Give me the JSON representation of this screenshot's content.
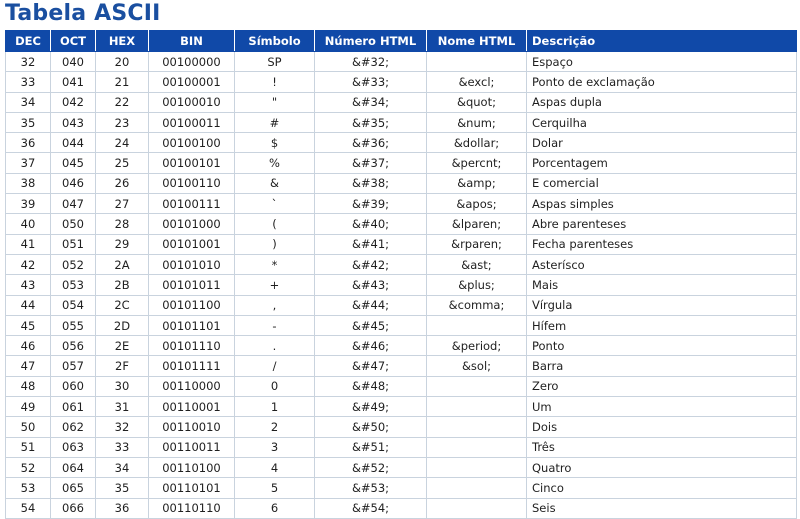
{
  "title": "Tabela ASCII",
  "headers": {
    "dec": "DEC",
    "oct": "OCT",
    "hex": "HEX",
    "bin": "BIN",
    "symbol": "Símbolo",
    "html_number": "Número HTML",
    "html_name": "Nome HTML",
    "description": "Descrição"
  },
  "rows": [
    {
      "dec": "32",
      "oct": "040",
      "hex": "20",
      "bin": "00100000",
      "symbol": "SP",
      "html_number": "&#32;",
      "html_name": "",
      "description": "Espaço"
    },
    {
      "dec": "33",
      "oct": "041",
      "hex": "21",
      "bin": "00100001",
      "symbol": "!",
      "html_number": "&#33;",
      "html_name": "&excl;",
      "description": "Ponto de exclamação"
    },
    {
      "dec": "34",
      "oct": "042",
      "hex": "22",
      "bin": "00100010",
      "symbol": "\"",
      "html_number": "&#34;",
      "html_name": "&quot;",
      "description": "Aspas dupla"
    },
    {
      "dec": "35",
      "oct": "043",
      "hex": "23",
      "bin": "00100011",
      "symbol": "#",
      "html_number": "&#35;",
      "html_name": "&num;",
      "description": "Cerquilha"
    },
    {
      "dec": "36",
      "oct": "044",
      "hex": "24",
      "bin": "00100100",
      "symbol": "$",
      "html_number": "&#36;",
      "html_name": "&dollar;",
      "description": "Dolar"
    },
    {
      "dec": "37",
      "oct": "045",
      "hex": "25",
      "bin": "00100101",
      "symbol": "%",
      "html_number": "&#37;",
      "html_name": "&percnt;",
      "description": "Porcentagem"
    },
    {
      "dec": "38",
      "oct": "046",
      "hex": "26",
      "bin": "00100110",
      "symbol": "&",
      "html_number": "&#38;",
      "html_name": "&amp;",
      "description": "E comercial"
    },
    {
      "dec": "39",
      "oct": "047",
      "hex": "27",
      "bin": "00100111",
      "symbol": "`",
      "html_number": "&#39;",
      "html_name": "&apos;",
      "description": "Aspas simples"
    },
    {
      "dec": "40",
      "oct": "050",
      "hex": "28",
      "bin": "00101000",
      "symbol": "(",
      "html_number": "&#40;",
      "html_name": "&lparen;",
      "description": "Abre parenteses"
    },
    {
      "dec": "41",
      "oct": "051",
      "hex": "29",
      "bin": "00101001",
      "symbol": ")",
      "html_number": "&#41;",
      "html_name": "&rparen;",
      "description": "Fecha parenteses"
    },
    {
      "dec": "42",
      "oct": "052",
      "hex": "2A",
      "bin": "00101010",
      "symbol": "*",
      "html_number": "&#42;",
      "html_name": "&ast;",
      "description": "Asterísco"
    },
    {
      "dec": "43",
      "oct": "053",
      "hex": "2B",
      "bin": "00101011",
      "symbol": "+",
      "html_number": "&#43;",
      "html_name": "&plus;",
      "description": "Mais"
    },
    {
      "dec": "44",
      "oct": "054",
      "hex": "2C",
      "bin": "00101100",
      "symbol": ",",
      "html_number": "&#44;",
      "html_name": "&comma;",
      "description": "Vírgula"
    },
    {
      "dec": "45",
      "oct": "055",
      "hex": "2D",
      "bin": "00101101",
      "symbol": "-",
      "html_number": "&#45;",
      "html_name": "",
      "description": "Hífem"
    },
    {
      "dec": "46",
      "oct": "056",
      "hex": "2E",
      "bin": "00101110",
      "symbol": ".",
      "html_number": "&#46;",
      "html_name": "&period;",
      "description": "Ponto"
    },
    {
      "dec": "47",
      "oct": "057",
      "hex": "2F",
      "bin": "00101111",
      "symbol": "/",
      "html_number": "&#47;",
      "html_name": "&sol;",
      "description": "Barra"
    },
    {
      "dec": "48",
      "oct": "060",
      "hex": "30",
      "bin": "00110000",
      "symbol": "0",
      "html_number": "&#48;",
      "html_name": "",
      "description": "Zero"
    },
    {
      "dec": "49",
      "oct": "061",
      "hex": "31",
      "bin": "00110001",
      "symbol": "1",
      "html_number": "&#49;",
      "html_name": "",
      "description": "Um"
    },
    {
      "dec": "50",
      "oct": "062",
      "hex": "32",
      "bin": "00110010",
      "symbol": "2",
      "html_number": "&#50;",
      "html_name": "",
      "description": "Dois"
    },
    {
      "dec": "51",
      "oct": "063",
      "hex": "33",
      "bin": "00110011",
      "symbol": "3",
      "html_number": "&#51;",
      "html_name": "",
      "description": "Três"
    },
    {
      "dec": "52",
      "oct": "064",
      "hex": "34",
      "bin": "00110100",
      "symbol": "4",
      "html_number": "&#52;",
      "html_name": "",
      "description": "Quatro"
    },
    {
      "dec": "53",
      "oct": "065",
      "hex": "35",
      "bin": "00110101",
      "symbol": "5",
      "html_number": "&#53;",
      "html_name": "",
      "description": "Cinco"
    },
    {
      "dec": "54",
      "oct": "066",
      "hex": "36",
      "bin": "00110110",
      "symbol": "6",
      "html_number": "&#54;",
      "html_name": "",
      "description": "Seis"
    }
  ],
  "colors": {
    "title": "#1a4fa0",
    "header_bg": "#1049a8",
    "header_text": "#ffffff",
    "grid": "#c9d3de"
  }
}
